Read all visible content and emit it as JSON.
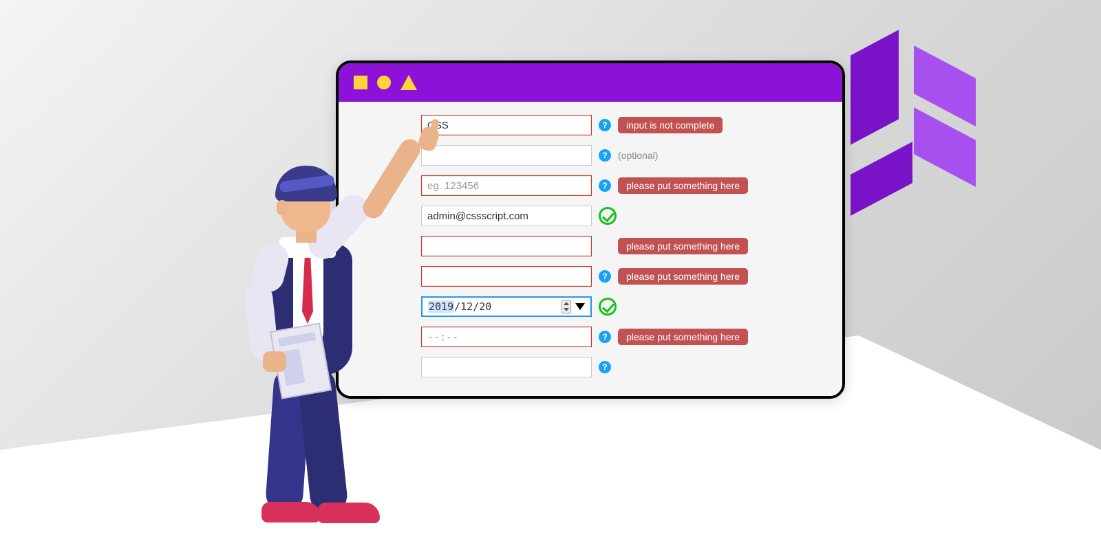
{
  "colors": {
    "accent": "#8b12d6",
    "logo_dark": "#7a13c7",
    "logo_light": "#a84ff0",
    "error": "#c25151",
    "success": "#14c21b",
    "help": "#17a2f5",
    "titlebar_glyph": "#ffd43b"
  },
  "form": {
    "rows": [
      {
        "id": "text1",
        "value": "CSS",
        "placeholder": "",
        "state": "error",
        "help": true,
        "message": "input is not complete",
        "message_type": "error"
      },
      {
        "id": "text2",
        "value": "",
        "placeholder": "",
        "state": "neutral",
        "help": true,
        "message": "(optional)",
        "message_type": "hint"
      },
      {
        "id": "text3",
        "value": "",
        "placeholder": "eg. 123456",
        "state": "error",
        "help": true,
        "message": "please put something here",
        "message_type": "error"
      },
      {
        "id": "email",
        "value": "admin@cssscript.com",
        "placeholder": "",
        "state": "valid",
        "help": false,
        "message": "",
        "message_type": ""
      },
      {
        "id": "text4",
        "value": "",
        "placeholder": "",
        "state": "error",
        "help": false,
        "message": "please put something here",
        "message_type": "error"
      },
      {
        "id": "text5",
        "value": "",
        "placeholder": "",
        "state": "error",
        "help": true,
        "message": "please put something here",
        "message_type": "error"
      },
      {
        "id": "date",
        "value": "2019/12/20",
        "selected_part": "2019",
        "state": "valid-focus",
        "help": false,
        "message": "",
        "message_type": ""
      },
      {
        "id": "time",
        "value": "",
        "placeholder": "--:--",
        "state": "error",
        "help": true,
        "message": "please put something here",
        "message_type": "error"
      },
      {
        "id": "text6",
        "value": "",
        "placeholder": "",
        "state": "neutral",
        "help": true,
        "message": "",
        "message_type": ""
      }
    ]
  }
}
